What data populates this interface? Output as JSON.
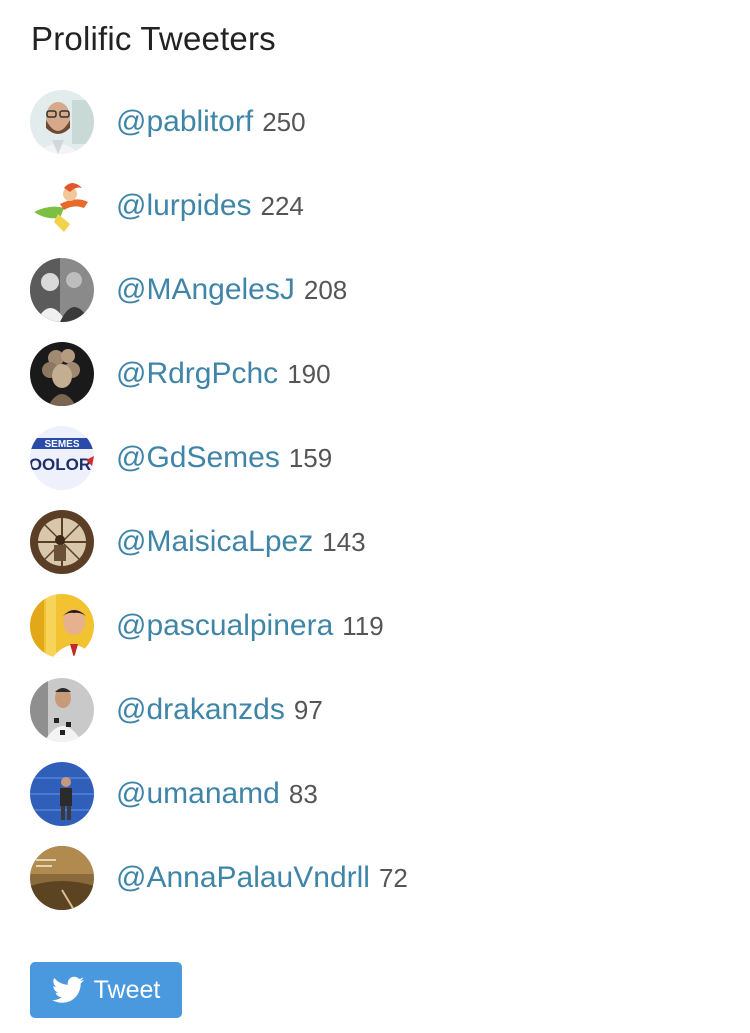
{
  "title": "Prolific Tweeters",
  "tweeters": [
    {
      "handle": "@pablitorf",
      "count": "250",
      "avatar": "avatar-man-glasses-beard"
    },
    {
      "handle": "@lurpides",
      "count": "224",
      "avatar": "avatar-cartoon-superhero"
    },
    {
      "handle": "@MAngelesJ",
      "count": "208",
      "avatar": "avatar-bw-photo"
    },
    {
      "handle": "@RdrgPchc",
      "count": "190",
      "avatar": "avatar-stone-sculpture"
    },
    {
      "handle": "@GdSemes",
      "count": "159",
      "avatar": "avatar-semes-text-logo",
      "avatar_text_top": "SEMES",
      "avatar_text_bottom": "OOLOR"
    },
    {
      "handle": "@MaisicaLpez",
      "count": "143",
      "avatar": "avatar-round-window"
    },
    {
      "handle": "@pascualpinera",
      "count": "119",
      "avatar": "avatar-man-yellow-background"
    },
    {
      "handle": "@drakanzds",
      "count": "97",
      "avatar": "avatar-man-patterned-shirt"
    },
    {
      "handle": "@umanamd",
      "count": "83",
      "avatar": "avatar-man-blue-background"
    },
    {
      "handle": "@AnnaPalauVndrll",
      "count": "72",
      "avatar": "avatar-sepia-landscape"
    }
  ],
  "tweet_button": {
    "label": "Tweet",
    "icon": "twitter-bird-icon"
  },
  "colors": {
    "handle": "#3f85a8",
    "count": "#555555",
    "title": "#222222",
    "button": "#4a99df"
  }
}
